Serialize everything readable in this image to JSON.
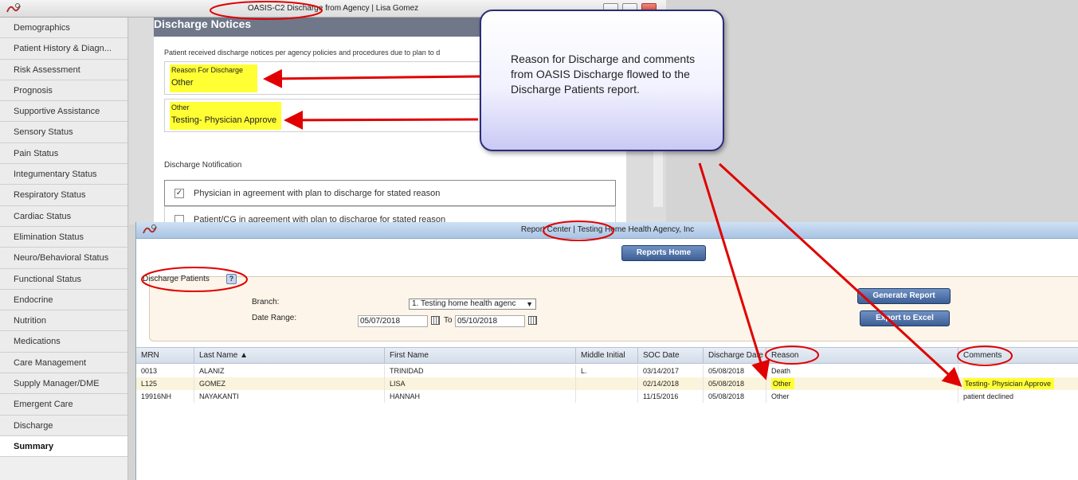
{
  "oasis_window": {
    "title": "OASIS-C2 Discharge from Agency | Lisa Gomez",
    "sidebar": {
      "items": [
        {
          "label": "Demographics",
          "active": false
        },
        {
          "label": "Patient History & Diagn...",
          "active": false
        },
        {
          "label": "Risk Assessment",
          "active": false
        },
        {
          "label": "Prognosis",
          "active": false
        },
        {
          "label": "Supportive Assistance",
          "active": false
        },
        {
          "label": "Sensory Status",
          "active": false
        },
        {
          "label": "Pain Status",
          "active": false
        },
        {
          "label": "Integumentary Status",
          "active": false
        },
        {
          "label": "Respiratory Status",
          "active": false
        },
        {
          "label": "Cardiac Status",
          "active": false
        },
        {
          "label": "Elimination Status",
          "active": false
        },
        {
          "label": "Neuro/Behavioral Status",
          "active": false
        },
        {
          "label": "Functional Status",
          "active": false
        },
        {
          "label": "Endocrine",
          "active": false
        },
        {
          "label": "Nutrition",
          "active": false
        },
        {
          "label": "Medications",
          "active": false
        },
        {
          "label": "Care Management",
          "active": false
        },
        {
          "label": "Supply Manager/DME",
          "active": false
        },
        {
          "label": "Emergent Care",
          "active": false
        },
        {
          "label": "Discharge",
          "active": false
        },
        {
          "label": "Summary",
          "active": true
        }
      ]
    },
    "notices": {
      "title": "Discharge Notices",
      "description": "Patient received discharge notices per agency policies and procedures due to plan to d",
      "reason_label": "Reason For Discharge",
      "reason_value": "Other",
      "other_label": "Other",
      "other_value": "Testing- Physician Approve",
      "notification_label": "Discharge Notification",
      "checks": [
        {
          "label": "Physician in agreement with plan to discharge for stated reason",
          "checked": true,
          "mark": "✓"
        },
        {
          "label": "Patient/CG in agreement with plan to discharge for stated reason",
          "checked": false,
          "mark": ""
        }
      ]
    }
  },
  "callout": {
    "text": "Reason for Discharge and comments from OASIS Discharge flowed to the Discharge Patients report."
  },
  "report_window": {
    "title": "Report Center | Testing Home Health Agency, Inc",
    "reports_home_button": "Reports Home",
    "panel_title": "Discharge Patients",
    "help_icon": "?",
    "branch_label": "Branch:",
    "branch_value": "1. Testing home health agenc",
    "branch_arrow": "▼",
    "date_range_label": "Date Range:",
    "date_from": "05/07/2018",
    "date_to_label": "To",
    "date_to": "05/10/2018",
    "generate_button": "Generate Report",
    "export_button": "Export to Excel",
    "table": {
      "columns": [
        "MRN",
        "Last Name ▲",
        "First Name",
        "Middle Initial",
        "SOC Date",
        "Discharge Date",
        "Reason",
        "Comments"
      ],
      "rows": [
        [
          "0013",
          "ALANIZ",
          "TRINIDAD",
          "L.",
          "03/14/2017",
          "05/08/2018",
          "Death",
          ""
        ],
        [
          "L125",
          "GOMEZ",
          "LISA",
          "",
          "02/14/2018",
          "05/08/2018",
          "Other",
          "Testing- Physician Approve"
        ],
        [
          "19916NH",
          "NAYAKANTI",
          "HANNAH",
          "",
          "11/15/2016",
          "05/08/2018",
          "Other",
          "patient declined"
        ]
      ]
    }
  },
  "colors": {
    "highlight": "#ffff33",
    "annotation_red": "#e00000",
    "callout_border": "#2c2c7a",
    "button_blue": "#3d5f95",
    "panel_gray": "#6f7789"
  },
  "icons": {
    "app": "app-logo-icon",
    "calendar": "calendar-icon",
    "help": "help-icon",
    "check": "checkmark-icon"
  }
}
